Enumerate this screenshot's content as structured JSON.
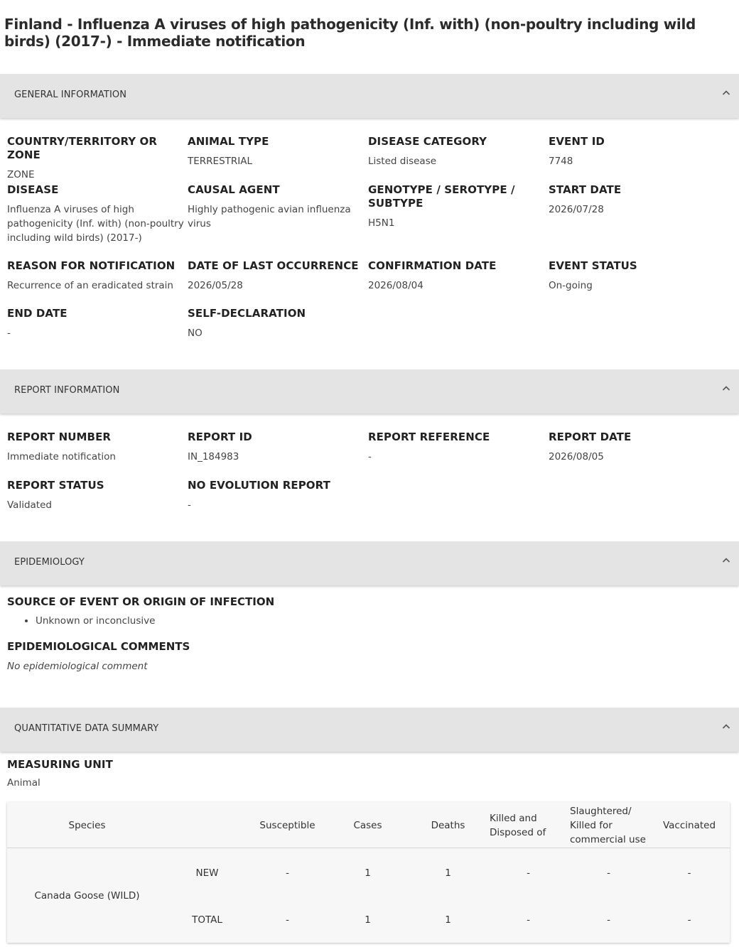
{
  "page": {
    "title": "Finland - Influenza A viruses of high pathogenicity (Inf. with) (non-poultry including wild birds) (2017-) - Immediate notification"
  },
  "sections": {
    "general": "GENERAL INFORMATION",
    "report": "REPORT INFORMATION",
    "epidemiology": "EPIDEMIOLOGY",
    "quantitative": "QUANTITATIVE DATA SUMMARY"
  },
  "general": {
    "country_label": "COUNTRY/TERRITORY OR ZONE",
    "country_value": "ZONE",
    "animal_type_label": "ANIMAL TYPE",
    "animal_type_value": "TERRESTRIAL",
    "disease_category_label": "DISEASE CATEGORY",
    "disease_category_value": "Listed disease",
    "event_id_label": "EVENT ID",
    "event_id_value": "7748",
    "disease_label": "DISEASE",
    "disease_value": "Influenza A viruses of high pathogenicity (Inf. with) (non-poultry including wild birds) (2017-)",
    "causal_agent_label": "CAUSAL AGENT",
    "causal_agent_value": "Highly pathogenic avian influenza virus",
    "genotype_label": "GENOTYPE / SEROTYPE / SUBTYPE",
    "genotype_value": "H5N1",
    "start_date_label": "START DATE",
    "start_date_value": "2026/07/28",
    "reason_label": "REASON FOR NOTIFICATION",
    "reason_value": "Recurrence of an eradicated strain",
    "last_occurrence_label": "DATE OF LAST OCCURRENCE",
    "last_occurrence_value": "2026/05/28",
    "confirmation_label": "CONFIRMATION DATE",
    "confirmation_value": "2026/08/04",
    "event_status_label": "EVENT STATUS",
    "event_status_value": "On-going",
    "end_date_label": "END DATE",
    "end_date_value": "-",
    "self_declaration_label": "SELF-DECLARATION",
    "self_declaration_value": "NO"
  },
  "report": {
    "number_label": "REPORT NUMBER",
    "number_value": "Immediate notification",
    "id_label": "REPORT ID",
    "id_value": "IN_184983",
    "reference_label": "REPORT REFERENCE",
    "reference_value": "-",
    "date_label": "REPORT DATE",
    "date_value": "2026/08/05",
    "status_label": "REPORT STATUS",
    "status_value": "Validated",
    "no_evolution_label": "NO EVOLUTION REPORT",
    "no_evolution_value": "-"
  },
  "epidemiology": {
    "source_label": "SOURCE OF EVENT OR ORIGIN OF INFECTION",
    "source_items": [
      "Unknown or inconclusive"
    ],
    "comments_label": "EPIDEMIOLOGICAL COMMENTS",
    "comments_value": "No epidemiological comment"
  },
  "quantitative": {
    "measuring_unit_label": "MEASURING UNIT",
    "measuring_unit_value": "Animal",
    "columns": [
      "Species",
      "Susceptible",
      "Cases",
      "Deaths",
      "Killed and Disposed of",
      "Slaughtered/ Killed for commercial use",
      "Vaccinated"
    ],
    "species": "Canada Goose (WILD)",
    "rows": [
      {
        "label": "NEW",
        "values": [
          "-",
          "1",
          "1",
          "-",
          "-",
          "-"
        ]
      },
      {
        "label": "TOTAL",
        "values": [
          "-",
          "1",
          "1",
          "-",
          "-",
          "-"
        ]
      }
    ]
  },
  "icons": {
    "collapse": "chevron-up-icon",
    "bullet": "bullet-dot"
  },
  "colors": {
    "section_bg": "#e4e4e4",
    "table_bg": "#f7f7f7"
  }
}
